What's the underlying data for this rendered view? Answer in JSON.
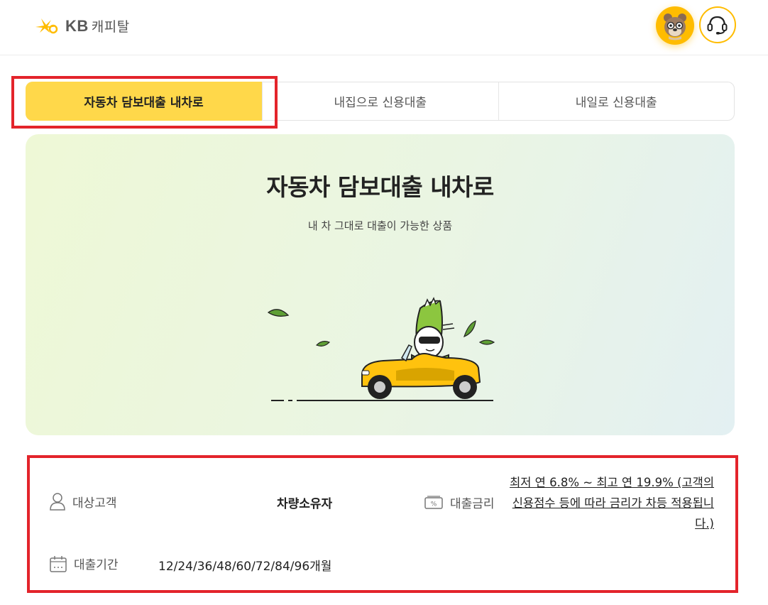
{
  "header": {
    "logo_text": "KB",
    "logo_sub": "캐피탈",
    "avatar_icon": "bear-avatar-icon",
    "support_icon": "headset-icon"
  },
  "tabs": [
    {
      "label": "자동차 담보대출 내차로",
      "active": true
    },
    {
      "label": "내집으로 신용대출",
      "active": false
    },
    {
      "label": "내일로 신용대출",
      "active": false
    }
  ],
  "hero": {
    "title": "자동차 담보대출 내차로",
    "subtitle": "내 차 그대로 대출이 가능한 상품"
  },
  "info": {
    "target_label": "대상고객",
    "target_value": "차량소유자",
    "rate_label": "대출금리",
    "rate_value": "최저 연 6.8% ~ 최고 연 19.9% (고객의 신용점수 등에 따라 금리가 차등 적용됩니다.)",
    "period_label": "대출기간",
    "period_value": "12/24/36/48/60/72/84/96개월"
  },
  "colors": {
    "accent": "#ffd84a",
    "brand": "#ffbc00",
    "highlight": "#e3242b"
  }
}
